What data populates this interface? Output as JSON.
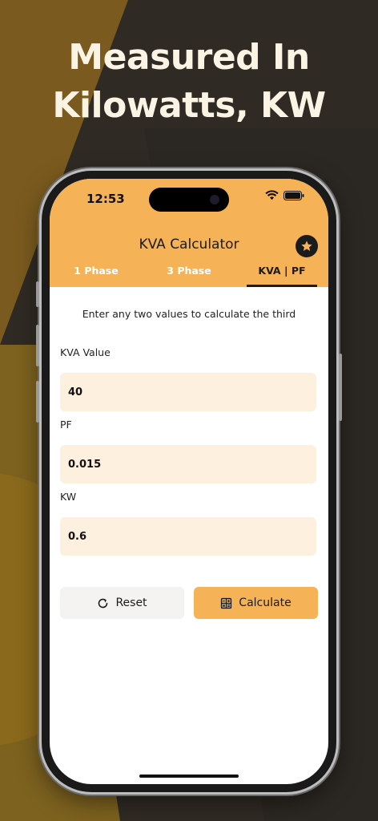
{
  "headline": {
    "line1": "Measured In",
    "line2": "Kilowatts, KW"
  },
  "status_bar": {
    "time": "12:53",
    "icons": [
      "wifi-icon",
      "battery-icon"
    ]
  },
  "app_bar": {
    "title": "KVA Calculator",
    "action_icon": "star-icon"
  },
  "tabs": [
    {
      "label": "1 Phase",
      "active": false
    },
    {
      "label": "3 Phase",
      "active": false
    },
    {
      "label": "KVA | PF",
      "active": true
    }
  ],
  "form": {
    "hint": "Enter any two values to calculate the third",
    "fields": [
      {
        "label": "KVA Value",
        "value": "40"
      },
      {
        "label": "PF",
        "value": "0.015"
      },
      {
        "label": "KW",
        "value": "0.6"
      }
    ]
  },
  "actions": {
    "reset_label": "Reset",
    "reset_icon": "refresh-icon",
    "calculate_label": "Calculate",
    "calculate_icon": "calculator-icon"
  },
  "colors": {
    "accent": "#f5b256",
    "field_bg": "#fdf0df",
    "background": "#2f2a23",
    "text_dark": "#1b1b1b"
  }
}
